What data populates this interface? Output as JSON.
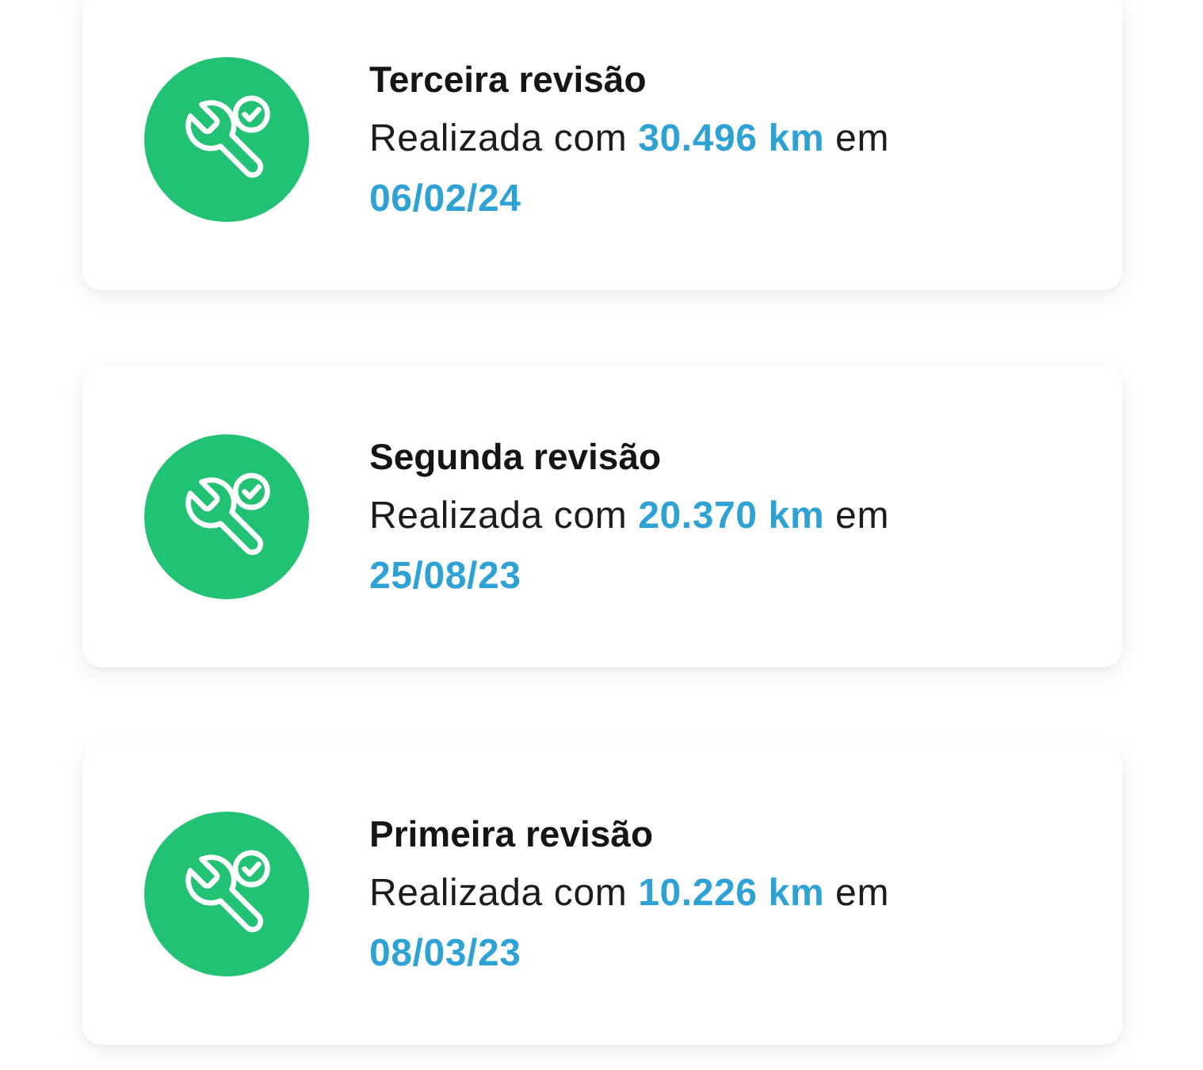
{
  "revisions": [
    {
      "title": "Terceira revisão",
      "details": "Realizada com **30.496 km** em **06/02/24**"
    },
    {
      "title": "Segunda revisão",
      "details": "Realizada com **20.370 km** em **25/08/23**"
    },
    {
      "title": "Primeira revisão",
      "details": "Realizada com **10.226 km** em **08/03/23**"
    }
  ]
}
